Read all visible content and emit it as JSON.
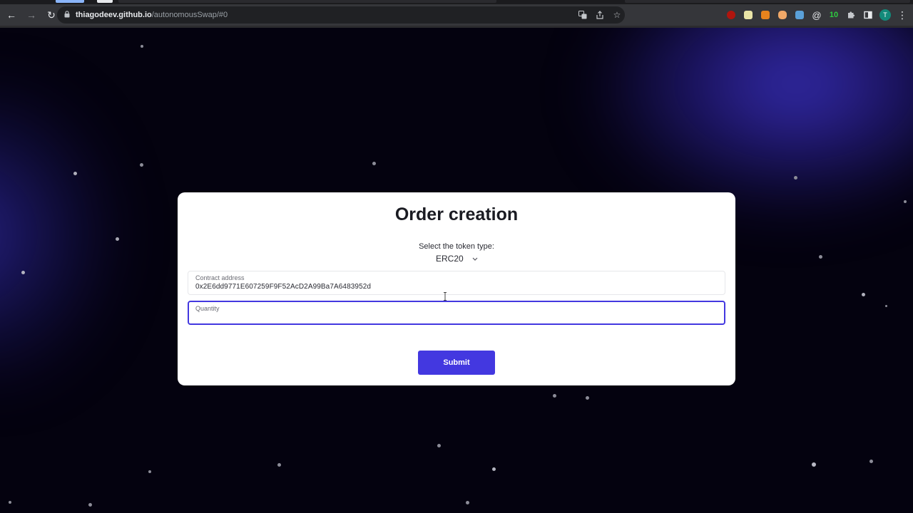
{
  "browser": {
    "url_host": "thiagodeev.github.io",
    "url_path": "/autonomousSwap/#0",
    "extension_badge": "10",
    "profile_initial": "T",
    "icons": {
      "back": "arrow-left-icon",
      "forward": "arrow-right-icon",
      "reload": "reload-icon",
      "lock": "lock-icon",
      "translate": "translate-icon",
      "share": "share-icon",
      "bookmark": "star-icon",
      "extensions": "puzzle-icon",
      "sidepanel": "sidepanel-icon",
      "menu": "kebab-menu-icon"
    }
  },
  "form": {
    "title": "Order creation",
    "token_type_label": "Select the token type:",
    "token_type_value": "ERC20",
    "contract_label": "Contract address",
    "contract_value": "0x2E6dd9771E607259F9F52AcD2A99Ba7A6483952d",
    "quantity_label": "Quantity",
    "quantity_value": "",
    "submit_label": "Submit"
  },
  "colors": {
    "accent": "#4338e0",
    "background": "#04020f",
    "card": "#ffffff"
  }
}
